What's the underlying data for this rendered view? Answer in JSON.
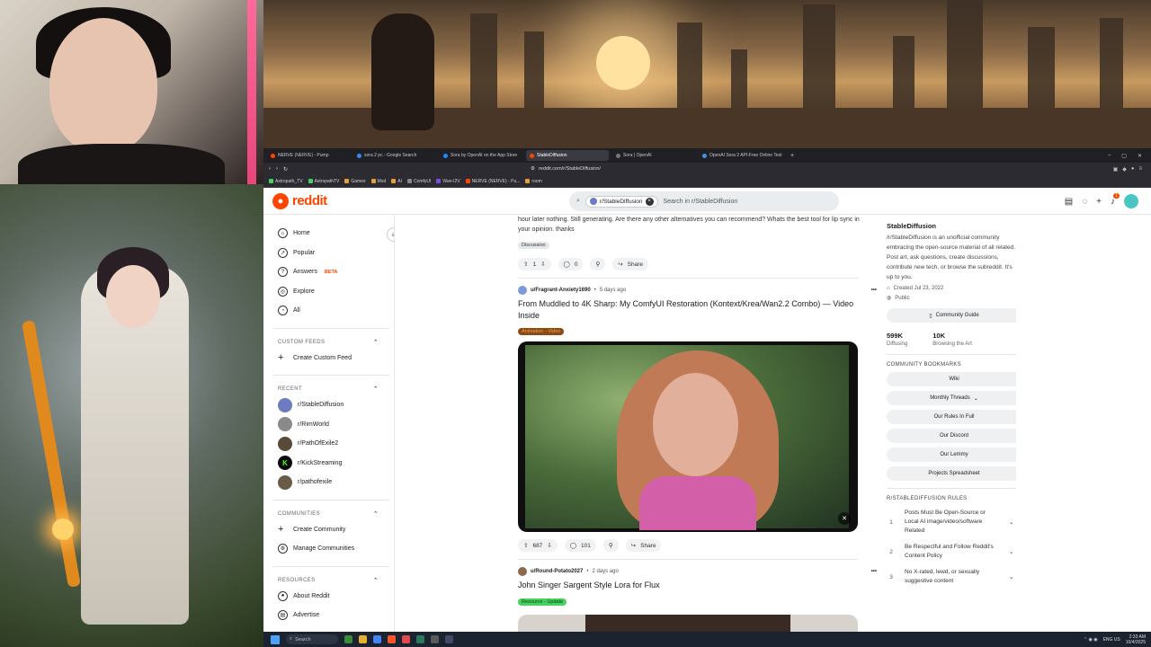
{
  "browser": {
    "tabs": [
      {
        "label": "NERVE (NERVE) - Pump",
        "active": false
      },
      {
        "label": "sora 2 pc - Google Search",
        "active": false
      },
      {
        "label": "Sora by OpenAI on the App Store",
        "active": false
      },
      {
        "label": "StableDiffusion",
        "active": true
      },
      {
        "label": "Sora | OpenAI",
        "active": false
      },
      {
        "label": "OpenAI Sora 2 API-Free Online Text",
        "active": false
      }
    ],
    "new_tab": "+",
    "url": "reddit.com/r/StableDiffusion/",
    "bookmarks": [
      "Astropath_TV",
      "AstropathTV",
      "Games",
      "Mod",
      "AI",
      "ComfyUI",
      "Wan-I2V",
      "NERVE (NERVE) - Pu...",
      "room"
    ]
  },
  "reddit": {
    "logo_text": "reddit",
    "search_chip": "r/StableDiffusion",
    "search_placeholder": "Search in r/StableDiffusion",
    "notification_count": "1"
  },
  "nav": {
    "main": [
      {
        "label": "Home",
        "icon": "home-icon"
      },
      {
        "label": "Popular",
        "icon": "popular-icon"
      },
      {
        "label": "Answers",
        "icon": "answers-icon",
        "badge": "BETA"
      },
      {
        "label": "Explore",
        "icon": "explore-icon"
      },
      {
        "label": "All",
        "icon": "all-icon"
      }
    ],
    "custom_feeds_title": "CUSTOM FEEDS",
    "create_custom_feed": "Create Custom Feed",
    "recent_title": "RECENT",
    "recent": [
      {
        "label": "r/StableDiffusion",
        "color": "#6d7cc2"
      },
      {
        "label": "r/RimWorld",
        "color": "#8a8a8a"
      },
      {
        "label": "r/PathOfExile2",
        "color": "#5a4a3a"
      },
      {
        "label": "r/KickStreaming",
        "color": "#0c0c0c"
      },
      {
        "label": "r/pathofexile",
        "color": "#6a5a48"
      }
    ],
    "communities_title": "COMMUNITIES",
    "create_community": "Create Community",
    "manage_communities": "Manage Communities",
    "resources_title": "RESOURCES",
    "about_reddit": "About Reddit",
    "advertise": "Advertise"
  },
  "feed": {
    "prev_post_text": "hour later nothing. Still generating. Are there any other alternatives you can recommend? Whats the best tool for lip sync in your opinion. thanks",
    "prev_post_tag": "Discussion",
    "prev_votes": "1",
    "prev_comments": "0",
    "share": "Share",
    "posts": [
      {
        "user": "u/Fragrant-Anxiety1690",
        "time": "5 days ago",
        "title": "From Muddled to 4K Sharp: My ComfyUI Restoration (Kontext/Krea/Wan2.2 Combo) — Video Inside",
        "flair": "Animation - Video",
        "flair_color": "#8a4a12",
        "votes": "687",
        "comments": "101"
      },
      {
        "user": "u/Round-Potato2027",
        "time": "2 days ago",
        "title": "John Singer Sargent Style Lora for Flux",
        "flair": "Resource - Update",
        "flair_color": "#46d160"
      }
    ]
  },
  "sidebar": {
    "name": "StableDiffusion",
    "description": "/r/StableDiffusion is an unofficial community embracing the open-source material of all related. Post art, ask questions, create discussions, contribute new tech, or browse the subreddit. It's up to you.",
    "created": "Created Jul 23, 2022",
    "visibility": "Public",
    "community_guide": "Community Guide",
    "members": "599K",
    "members_label": "Diffusing",
    "online": "10K",
    "online_label": "Browsing the Art",
    "bookmarks_title": "COMMUNITY BOOKMARKS",
    "bookmarks": [
      "Wiki",
      "Monthly Threads",
      "Our Rules In Full",
      "Our Discord",
      "Our Lemmy",
      "Projects Spreadsheet"
    ],
    "rules_title": "R/STABLEDIFFUSION RULES",
    "rules": [
      {
        "n": "1",
        "text": "Posts Must Be Open-Source or Local AI image/video/software Related"
      },
      {
        "n": "2",
        "text": "Be Respectful and Follow Reddit's Content Policy"
      },
      {
        "n": "3",
        "text": "No X-rated, lewd, or sexually suggestive content"
      }
    ]
  },
  "taskbar": {
    "search": "Search",
    "lang": "ENG US",
    "time": "2:33 AM",
    "date": "10/4/2025"
  }
}
